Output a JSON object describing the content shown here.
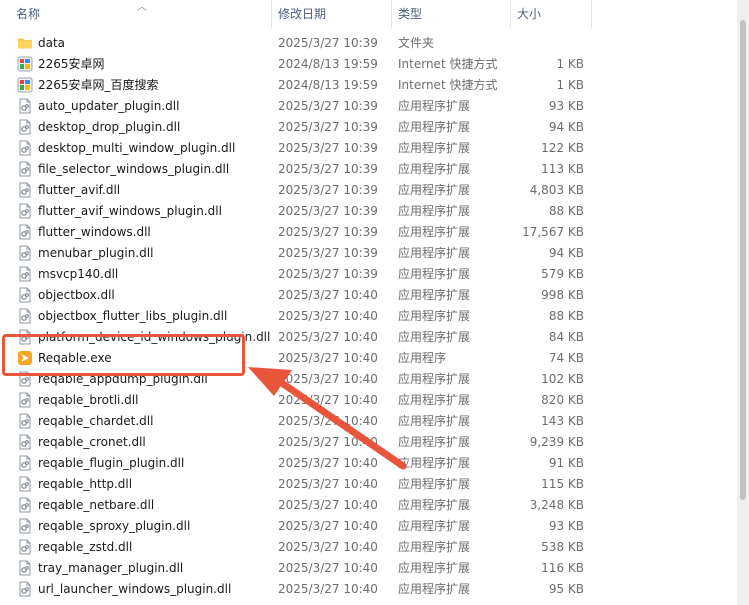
{
  "columns": {
    "name": "名称",
    "modified": "修改日期",
    "type": "类型",
    "size": "大小"
  },
  "files": [
    {
      "name": "data",
      "date": "2025/3/27 10:39",
      "type": "文件夹",
      "size": "",
      "icon": "folder-icon"
    },
    {
      "name": "2265安卓网",
      "date": "2024/8/13 19:59",
      "type": "Internet 快捷方式",
      "size": "1 KB",
      "icon": "internet-shortcut-icon"
    },
    {
      "name": "2265安卓网_百度搜索",
      "date": "2024/8/13 19:59",
      "type": "Internet 快捷方式",
      "size": "1 KB",
      "icon": "internet-shortcut-icon"
    },
    {
      "name": "auto_updater_plugin.dll",
      "date": "2025/3/27 10:39",
      "type": "应用程序扩展",
      "size": "93 KB",
      "icon": "dll-file-icon"
    },
    {
      "name": "desktop_drop_plugin.dll",
      "date": "2025/3/27 10:39",
      "type": "应用程序扩展",
      "size": "94 KB",
      "icon": "dll-file-icon"
    },
    {
      "name": "desktop_multi_window_plugin.dll",
      "date": "2025/3/27 10:39",
      "type": "应用程序扩展",
      "size": "122 KB",
      "icon": "dll-file-icon"
    },
    {
      "name": "file_selector_windows_plugin.dll",
      "date": "2025/3/27 10:39",
      "type": "应用程序扩展",
      "size": "113 KB",
      "icon": "dll-file-icon"
    },
    {
      "name": "flutter_avif.dll",
      "date": "2025/3/27 10:39",
      "type": "应用程序扩展",
      "size": "4,803 KB",
      "icon": "dll-file-icon"
    },
    {
      "name": "flutter_avif_windows_plugin.dll",
      "date": "2025/3/27 10:39",
      "type": "应用程序扩展",
      "size": "88 KB",
      "icon": "dll-file-icon"
    },
    {
      "name": "flutter_windows.dll",
      "date": "2025/3/27 10:39",
      "type": "应用程序扩展",
      "size": "17,567 KB",
      "icon": "dll-file-icon"
    },
    {
      "name": "menubar_plugin.dll",
      "date": "2025/3/27 10:39",
      "type": "应用程序扩展",
      "size": "94 KB",
      "icon": "dll-file-icon"
    },
    {
      "name": "msvcp140.dll",
      "date": "2025/3/27 10:39",
      "type": "应用程序扩展",
      "size": "579 KB",
      "icon": "dll-file-icon"
    },
    {
      "name": "objectbox.dll",
      "date": "2025/3/27 10:40",
      "type": "应用程序扩展",
      "size": "998 KB",
      "icon": "dll-file-icon"
    },
    {
      "name": "objectbox_flutter_libs_plugin.dll",
      "date": "2025/3/27 10:40",
      "type": "应用程序扩展",
      "size": "88 KB",
      "icon": "dll-file-icon"
    },
    {
      "name": "platform_device_id_windows_plugin.dll",
      "date": "2025/3/27 10:40",
      "type": "应用程序扩展",
      "size": "84 KB",
      "icon": "dll-file-icon"
    },
    {
      "name": "Reqable.exe",
      "date": "2025/3/27 10:40",
      "type": "应用程序",
      "size": "74 KB",
      "icon": "reqable-app-icon"
    },
    {
      "name": "reqable_appdump_plugin.dll",
      "date": "2025/3/27 10:40",
      "type": "应用程序扩展",
      "size": "102 KB",
      "icon": "dll-file-icon"
    },
    {
      "name": "reqable_brotli.dll",
      "date": "2025/3/27 10:40",
      "type": "应用程序扩展",
      "size": "820 KB",
      "icon": "dll-file-icon"
    },
    {
      "name": "reqable_chardet.dll",
      "date": "2025/3/27 10:40",
      "type": "应用程序扩展",
      "size": "143 KB",
      "icon": "dll-file-icon"
    },
    {
      "name": "reqable_cronet.dll",
      "date": "2025/3/27 10:40",
      "type": "应用程序扩展",
      "size": "9,239 KB",
      "icon": "dll-file-icon"
    },
    {
      "name": "reqable_flugin_plugin.dll",
      "date": "2025/3/27 10:40",
      "type": "应用程序扩展",
      "size": "91 KB",
      "icon": "dll-file-icon"
    },
    {
      "name": "reqable_http.dll",
      "date": "2025/3/27 10:40",
      "type": "应用程序扩展",
      "size": "115 KB",
      "icon": "dll-file-icon"
    },
    {
      "name": "reqable_netbare.dll",
      "date": "2025/3/27 10:40",
      "type": "应用程序扩展",
      "size": "3,248 KB",
      "icon": "dll-file-icon"
    },
    {
      "name": "reqable_sproxy_plugin.dll",
      "date": "2025/3/27 10:40",
      "type": "应用程序扩展",
      "size": "93 KB",
      "icon": "dll-file-icon"
    },
    {
      "name": "reqable_zstd.dll",
      "date": "2025/3/27 10:40",
      "type": "应用程序扩展",
      "size": "538 KB",
      "icon": "dll-file-icon"
    },
    {
      "name": "tray_manager_plugin.dll",
      "date": "2025/3/27 10:40",
      "type": "应用程序扩展",
      "size": "116 KB",
      "icon": "dll-file-icon"
    },
    {
      "name": "url_launcher_windows_plugin.dll",
      "date": "2025/3/27 10:40",
      "type": "应用程序扩展",
      "size": "95 KB",
      "icon": "dll-file-icon"
    }
  ],
  "annotation": {
    "color": "#e8553b",
    "highlighted_file": "Reqable.exe"
  }
}
